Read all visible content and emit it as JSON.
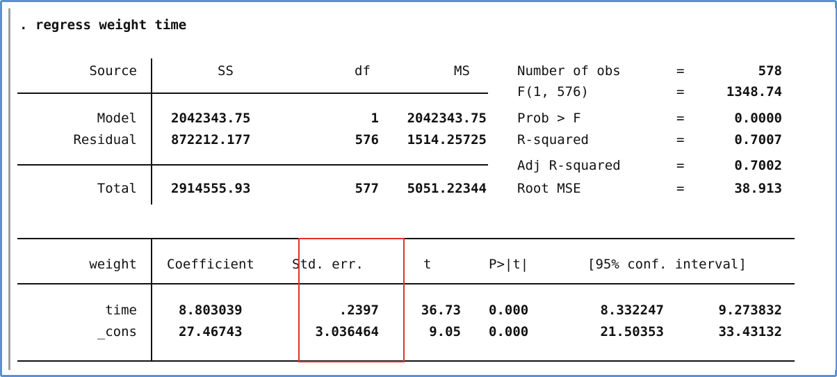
{
  "command": ". regress weight time",
  "anova": {
    "headers": {
      "source": "Source",
      "ss": "SS",
      "df": "df",
      "ms": "MS"
    },
    "rows": [
      {
        "source": "Model",
        "ss": "2042343.75",
        "df": "1",
        "ms": "2042343.75"
      },
      {
        "source": "Residual",
        "ss": "872212.177",
        "df": "576",
        "ms": "1514.25725"
      }
    ],
    "total": {
      "source": "Total",
      "ss": "2914555.93",
      "df": "577",
      "ms": "5051.22344"
    }
  },
  "stats": [
    {
      "label": "Number of obs",
      "eq": "=",
      "value": "578"
    },
    {
      "label": "F(1, 576)",
      "eq": "=",
      "value": "1348.74"
    },
    {
      "label": "Prob > F",
      "eq": "=",
      "value": "0.0000"
    },
    {
      "label": "R-squared",
      "eq": "=",
      "value": "0.7007"
    },
    {
      "label": "Adj R-squared",
      "eq": "=",
      "value": "0.7002"
    },
    {
      "label": "Root MSE",
      "eq": "=",
      "value": "38.913"
    }
  ],
  "coef": {
    "headers": {
      "depvar": "weight",
      "coef": "Coefficient",
      "se": "Std. err.",
      "t": "t",
      "p": "P>|t|",
      "ci": "[95% conf. interval]"
    },
    "rows": [
      {
        "name": "time",
        "coef": "8.803039",
        "se": ".2397",
        "t": "36.73",
        "p": "0.000",
        "ci_low": "8.332247",
        "ci_high": "9.273832"
      },
      {
        "name": "_cons",
        "coef": "27.46743",
        "se": "3.036464",
        "t": "9.05",
        "p": "0.000",
        "ci_low": "21.50353",
        "ci_high": "33.43132"
      }
    ]
  },
  "colors": {
    "frame_border": "#5b8fd6",
    "highlight": "#e4312b",
    "text": "#111111"
  }
}
